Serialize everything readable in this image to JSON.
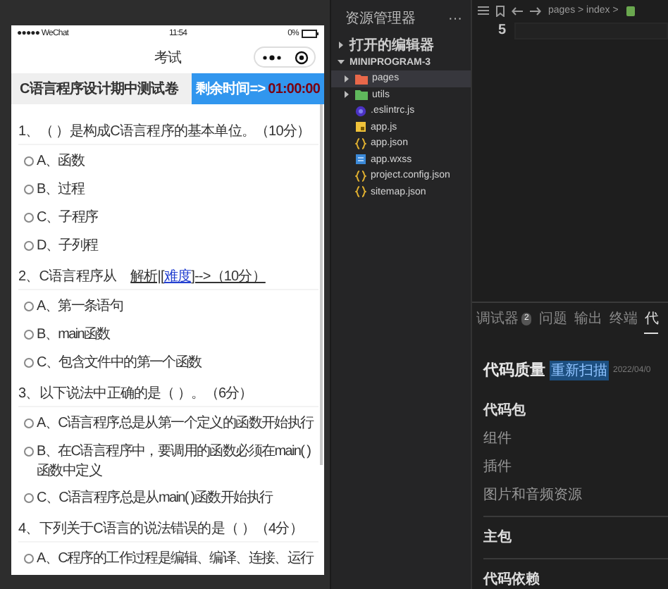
{
  "simulator": {
    "status_bar": {
      "carrier": "●●●●● WeChat",
      "time": "11:54",
      "battery": "0%"
    },
    "nav_title": "考试",
    "exam_title": "C语言程序设计期中测试卷",
    "timer": {
      "label": "剩余时间=>",
      "value": "01:00:00"
    },
    "questions": [
      {
        "text": "1、（ ）是构成C语言程序的基本单位。（10分）",
        "options": [
          {
            "label": "A、函数",
            "selected": false
          },
          {
            "label": "B、过程",
            "selected": false
          },
          {
            "label": "C、子程序",
            "selected": false
          },
          {
            "label": "D、子列程",
            "selected": false
          }
        ]
      },
      {
        "text": "2、C语言程序从",
        "blank": "解析|[",
        "link": "难度",
        "tail": "]-->（10分）",
        "options": [
          {
            "label": "A、第一条语句",
            "selected": false
          },
          {
            "label": "B、main函数",
            "selected": false
          },
          {
            "label": "C、包含文件中的第一个函数",
            "selected": false
          }
        ]
      },
      {
        "text": "3、以下说法中正确的是（ ）。（6分）",
        "options": [
          {
            "label": "A、C语言程序总是从第一个定义的函数开始执行",
            "selected": false
          },
          {
            "label": "B、在C语言程序中，要调用的函数必须在main( )函数中定义",
            "selected": false
          },
          {
            "label": "C、C语言程序总是从main( )函数开始执行",
            "selected": false
          }
        ]
      },
      {
        "text": "4、下列关于C语言的说法错误的是（ ）（4分）",
        "options": [
          {
            "label": "A、C程序的工作过程是编辑、编译、连接、运行",
            "selected": false
          }
        ]
      }
    ]
  },
  "explorer": {
    "title": "资源管理器",
    "more": "···",
    "open_editors": {
      "label": "打开的编辑器",
      "expanded": false
    },
    "project": {
      "label": "MINIPROGRAM-3",
      "expanded": true,
      "children": [
        {
          "name": "pages",
          "kind": "folder",
          "color": "#e8684a",
          "expanded": false,
          "selected": true
        },
        {
          "name": "utils",
          "kind": "folder",
          "color": "#5fb85c",
          "expanded": false,
          "selected": false
        },
        {
          "name": ".eslintrc.js",
          "kind": "eslint",
          "selected": false
        },
        {
          "name": "app.js",
          "kind": "js",
          "selected": false
        },
        {
          "name": "app.json",
          "kind": "json",
          "selected": false
        },
        {
          "name": "app.wxss",
          "kind": "wxss",
          "selected": false
        },
        {
          "name": "project.config.json",
          "kind": "json",
          "selected": false
        },
        {
          "name": "sitemap.json",
          "kind": "json",
          "selected": false
        }
      ]
    }
  },
  "editor": {
    "breadcrumb": "pages > index >",
    "line_number": "5",
    "panel_tabs": [
      {
        "label": "调试器",
        "badge": "2",
        "selected": false
      },
      {
        "label": "问题",
        "selected": false
      },
      {
        "label": "输出",
        "selected": false
      },
      {
        "label": "终端",
        "selected": false
      },
      {
        "label": "代",
        "selected": true
      }
    ],
    "report": {
      "title": "代码质量",
      "action": "重新扫描",
      "date": "2022/04/0",
      "sections": [
        {
          "heading": "代码包",
          "items": [
            "组件",
            "插件",
            "图片和音频资源"
          ]
        },
        {
          "heading": "主包"
        },
        {
          "heading": "代码依赖"
        }
      ]
    }
  }
}
